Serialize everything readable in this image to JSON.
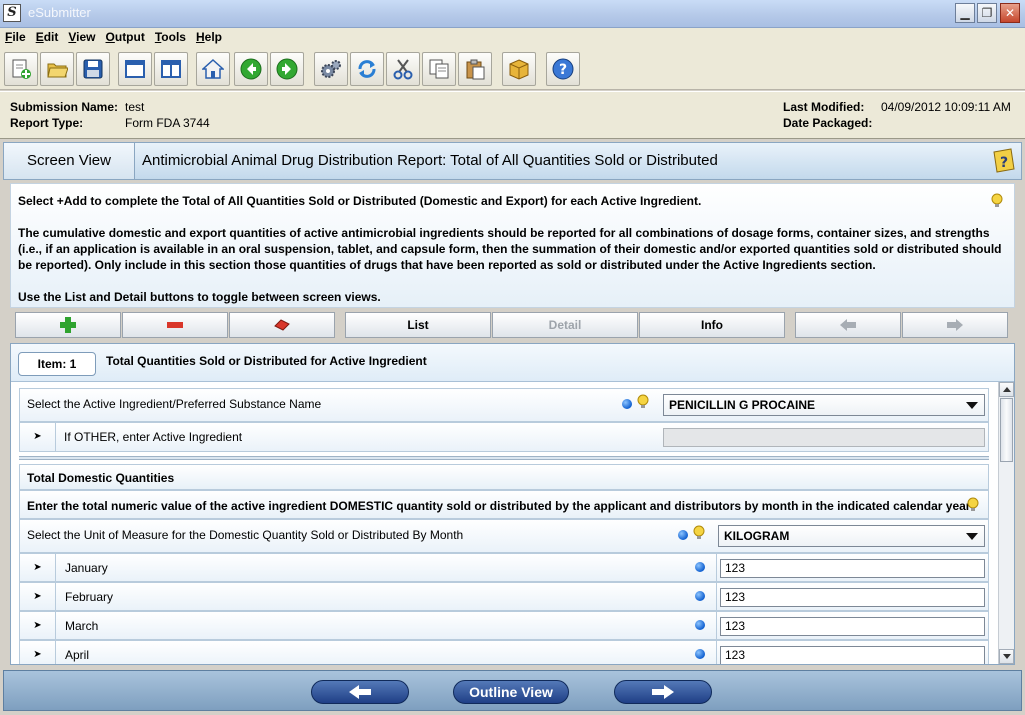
{
  "window": {
    "title": "eSubmitter",
    "icon_letter": "S"
  },
  "menu": [
    "File",
    "Edit",
    "View",
    "Output",
    "Tools",
    "Help"
  ],
  "toolbar": {
    "buttons": [
      "new-document-icon",
      "open-folder-icon",
      "save-icon",
      "window-icon",
      "split-view-icon",
      "home-icon",
      "back-arrow-icon",
      "forward-arrow-icon",
      "gears-icon",
      "refresh-icon",
      "cut-icon",
      "copy-icon",
      "paste-icon",
      "package-icon",
      "help-icon"
    ]
  },
  "submission": {
    "name_label": "Submission Name:",
    "name_value": "test",
    "type_label": "Report Type:",
    "type_value": "Form FDA 3744",
    "modified_label": "Last Modified:",
    "modified_value": "04/09/2012 10:09:11 AM",
    "packaged_label": "Date Packaged:",
    "packaged_value": ""
  },
  "screen": {
    "tab_label": "Screen View",
    "title": "Antimicrobial Animal Drug Distribution Report: Total of All Quantities Sold or Distributed"
  },
  "instructions": {
    "line1": "Select +Add to complete the Total of All Quantities Sold or Distributed (Domestic and Export) for each Active Ingredient.",
    "para2_l1": "The cumulative domestic and export quantities of active antimicrobial ingredients should be reported for all combinations of dosage forms, container sizes, and strengths",
    "para2_l2": "(i.e., if an application is available in an oral suspension, tablet, and capsule form, then the summation of their domestic and/or exported quantities sold or distributed should",
    "para2_l3": "be reported). Only include in this section those quantities of drugs that have been reported as sold or distributed under the Active Ingredients section.",
    "line4": "Use the List and Detail buttons to toggle between screen views."
  },
  "buttons": {
    "list": "List",
    "detail": "Detail",
    "info": "Info"
  },
  "item": {
    "badge": "Item: 1",
    "title": "Total Quantities Sold or Distributed for Active Ingredient",
    "ingredient_label": "Select the Active Ingredient/Preferred Substance Name",
    "ingredient_value": "PENICILLIN G PROCAINE",
    "other_label": "If OTHER, enter Active Ingredient",
    "other_value": ""
  },
  "domestic": {
    "section_title": "Total Domestic Quantities",
    "instruction": "Enter the total numeric value of the active ingredient DOMESTIC quantity sold or distributed by the applicant and distributors by month in the indicated calendar year",
    "uom_label": "Select the Unit of Measure for the Domestic Quantity Sold or Distributed By Month",
    "uom_value": "KILOGRAM",
    "months": [
      {
        "name": "January",
        "value": "123"
      },
      {
        "name": "February",
        "value": "123"
      },
      {
        "name": "March",
        "value": "123"
      },
      {
        "name": "April",
        "value": "123"
      }
    ]
  },
  "nav": {
    "outline": "Outline View"
  },
  "colors": {
    "accent": "#1f3f86",
    "info_dot": "#1060d0",
    "add_green": "#2fa32f",
    "remove_red": "#d9362a"
  }
}
